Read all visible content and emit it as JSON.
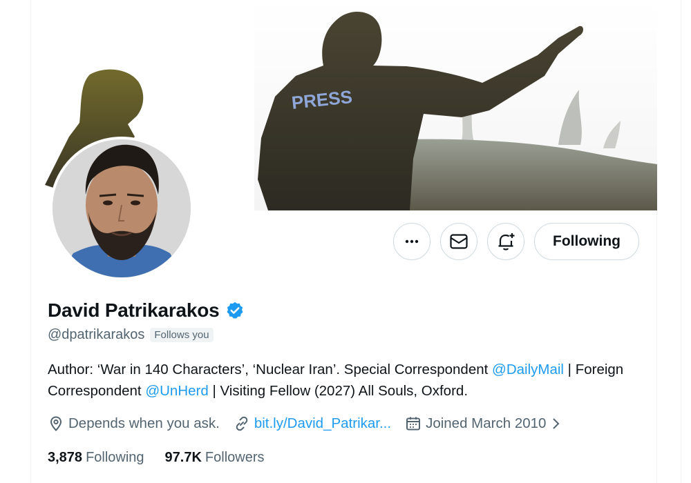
{
  "profile": {
    "name": "David Patrikarakos",
    "handle": "@dpatrikarakos",
    "follows_you": "Follows you",
    "verified": true,
    "bio": {
      "part1": "Author: ‘War in 140 Characters’, ‘Nuclear Iran’. Special Correspondent ",
      "mention1": "@DailyMail",
      "part2": " | Foreign Correspondent ",
      "mention2": "@UnHerd",
      "part3": " | Visiting Fellow (2027) All Souls, Oxford."
    },
    "location": "Depends when you ask.",
    "link": "bit.ly/David_Patrikar...",
    "joined": "Joined March 2010",
    "following_count": "3,878",
    "following_label": "Following",
    "followers_count": "97.7K",
    "followers_label": "Followers"
  },
  "banner": {
    "vest_text": "PRESS"
  },
  "actions": {
    "more_icon": "more-icon",
    "message_icon": "mail-icon",
    "notify_icon": "bell-plus-icon",
    "following_label": "Following"
  },
  "colors": {
    "accent": "#1d9bf0",
    "secondary_text": "#536471",
    "border": "#cfd9de"
  }
}
